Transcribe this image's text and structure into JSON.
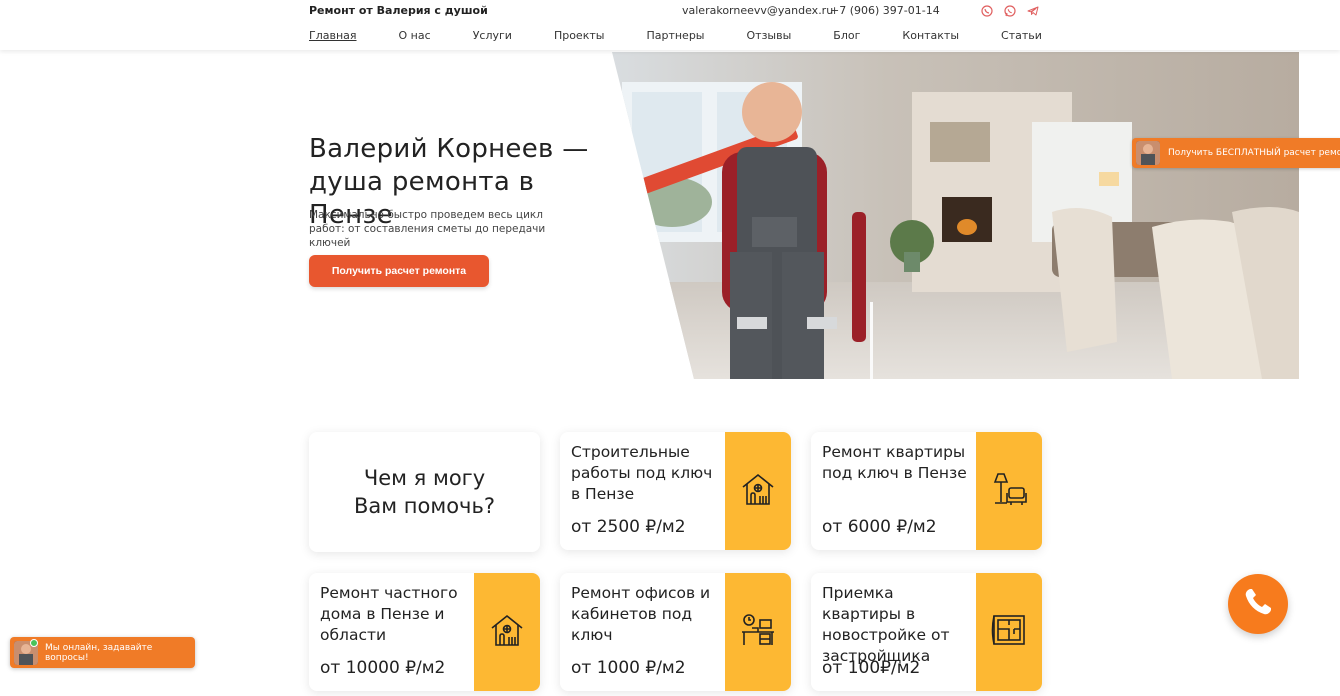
{
  "header": {
    "brand": "Ремонт от Валерия с душой",
    "email": "valerakorneevv@yandex.ru",
    "phone": "+7 (906) 397-01-14",
    "socials": [
      "viber-icon",
      "whatsapp-icon",
      "telegram-icon"
    ],
    "nav": [
      "Главная",
      "О нас",
      "Услуги",
      "Проекты",
      "Партнеры",
      "Отзывы",
      "Блог",
      "Контакты",
      "Статьи"
    ]
  },
  "hero": {
    "title": "Валерий Корнеев — душа ремонта в Пензе",
    "subtitle": "Максимально быстро проведем весь цикл работ: от составления сметы до передачи ключей",
    "button": "Получить расчет ремонта"
  },
  "promo_tab": "Получить БЕСПЛАТНЫЙ расчет ремонта",
  "services": {
    "heading": "Чем я могу Вам помочь?",
    "cards": [
      {
        "title": "Строительные работы под ключ в Пензе",
        "price": "от 2500 ₽/м2",
        "icon": "house-icon"
      },
      {
        "title": "Ремонт квартиры под ключ в Пензе",
        "price": "от 6000 ₽/м2",
        "icon": "armchair-lamp-icon"
      },
      {
        "title": "Ремонт частного дома в Пензе и области",
        "price": "от 10000 ₽/м2",
        "icon": "house-icon"
      },
      {
        "title": "Ремонт офисов и кабинетов под ключ",
        "price": "от 1000 ₽/м2",
        "icon": "office-desk-icon"
      },
      {
        "title": "Приемка квартиры в новостройке от застройщика",
        "price": "от 100₽/м2",
        "icon": "blueprint-icon"
      }
    ]
  },
  "chat_widget": "Мы онлайн, задавайте вопросы!",
  "colors": {
    "accent": "#e8572f",
    "card_side": "#fdb833",
    "call": "#f77b1d"
  }
}
